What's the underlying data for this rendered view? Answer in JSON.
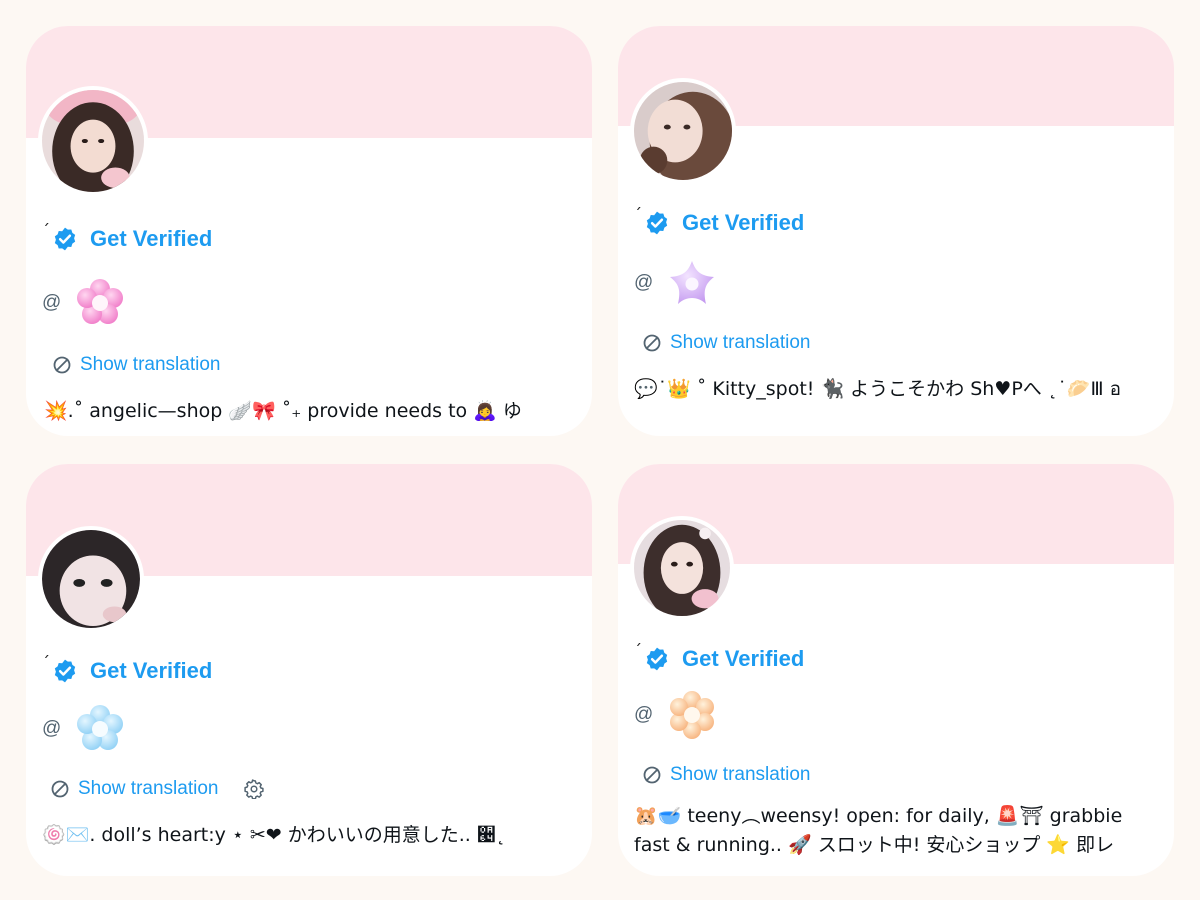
{
  "cards": [
    {
      "tick": "´",
      "verified_label": "Get Verified",
      "handle_prefix": "@",
      "flower_icon": "pink-flower-icon",
      "translation_label": "Show translation",
      "bio": "💥.˚ angelic—shop 🪽🎀 ˚₊ provide needs to 🙇‍♀️ ゆ"
    },
    {
      "tick": "´",
      "verified_label": "Get Verified",
      "handle_prefix": "@",
      "flower_icon": "lavender-star-flower-icon",
      "translation_label": "Show translation",
      "bio": "💬˙👑 ˚ Kitty_spot! 🐈‍⬛ ようこそかわ Sh♥Pへ ˛˙🥟Ⅲ อ"
    },
    {
      "tick": "´",
      "verified_label": "Get Verified",
      "handle_prefix": "@",
      "flower_icon": "blue-flower-icon",
      "translation_label": "Show translation",
      "bio": "🍥✉️.  doll’s heart:y  ⋆  ✂︎❤  かわいいの用意した..  ੤˛"
    },
    {
      "tick": "´",
      "verified_label": "Get Verified",
      "handle_prefix": "@",
      "flower_icon": "peach-flower-icon",
      "translation_label": "Show translation",
      "bio": "🐹🥣 teeny︵weensy! open: for daily, 🚨⛩ grabbie fast & running.. 🚀 スロット中! 安心ショップ ⭐ 即レ"
    }
  ],
  "colors": {
    "accent": "#1d9bf0",
    "banner": "#fde5ea",
    "background": "#fdf8f3"
  }
}
